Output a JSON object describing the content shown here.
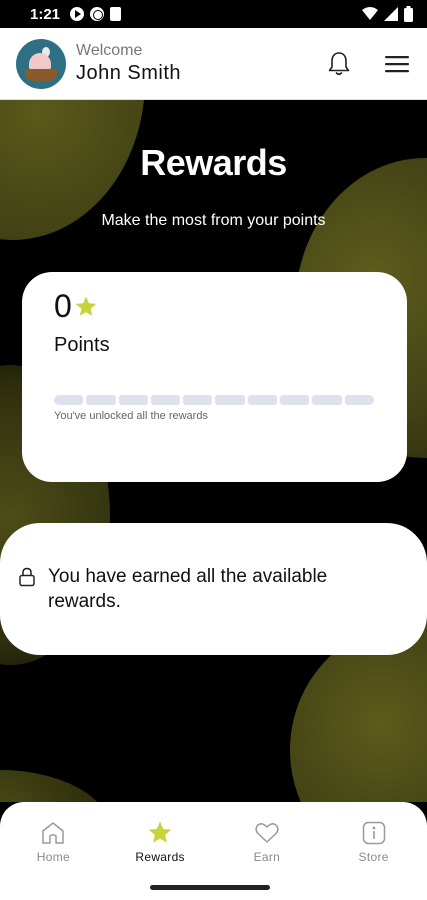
{
  "status_bar": {
    "time": "1:21",
    "icons": [
      "play-icon",
      "globe-icon",
      "sd-card-icon",
      "wifi-icon",
      "signal-icon",
      "battery-icon"
    ]
  },
  "header": {
    "welcome_label": "Welcome",
    "user_name": "John Smith",
    "icons": [
      "bell-icon",
      "menu-icon"
    ]
  },
  "main": {
    "title": "Rewards",
    "subtitle": "Make the most from your points"
  },
  "points_card": {
    "points_value": "0",
    "points_label": "Points",
    "progress_caption": "You've unlocked all the rewards",
    "progress_segments": 10,
    "accent_color": "#c7d33b"
  },
  "earned_card": {
    "message": "You have earned all the available rewards."
  },
  "bottom_nav": {
    "items": [
      {
        "label": "Home",
        "icon": "home-icon",
        "active": false
      },
      {
        "label": "Rewards",
        "icon": "star-icon",
        "active": true
      },
      {
        "label": "Earn",
        "icon": "heart-icon",
        "active": false
      },
      {
        "label": "Store",
        "icon": "info-icon",
        "active": false
      }
    ]
  },
  "colors": {
    "background": "#000000",
    "blob": "#4a4a16",
    "accent": "#c7d33b",
    "card": "#ffffff"
  }
}
